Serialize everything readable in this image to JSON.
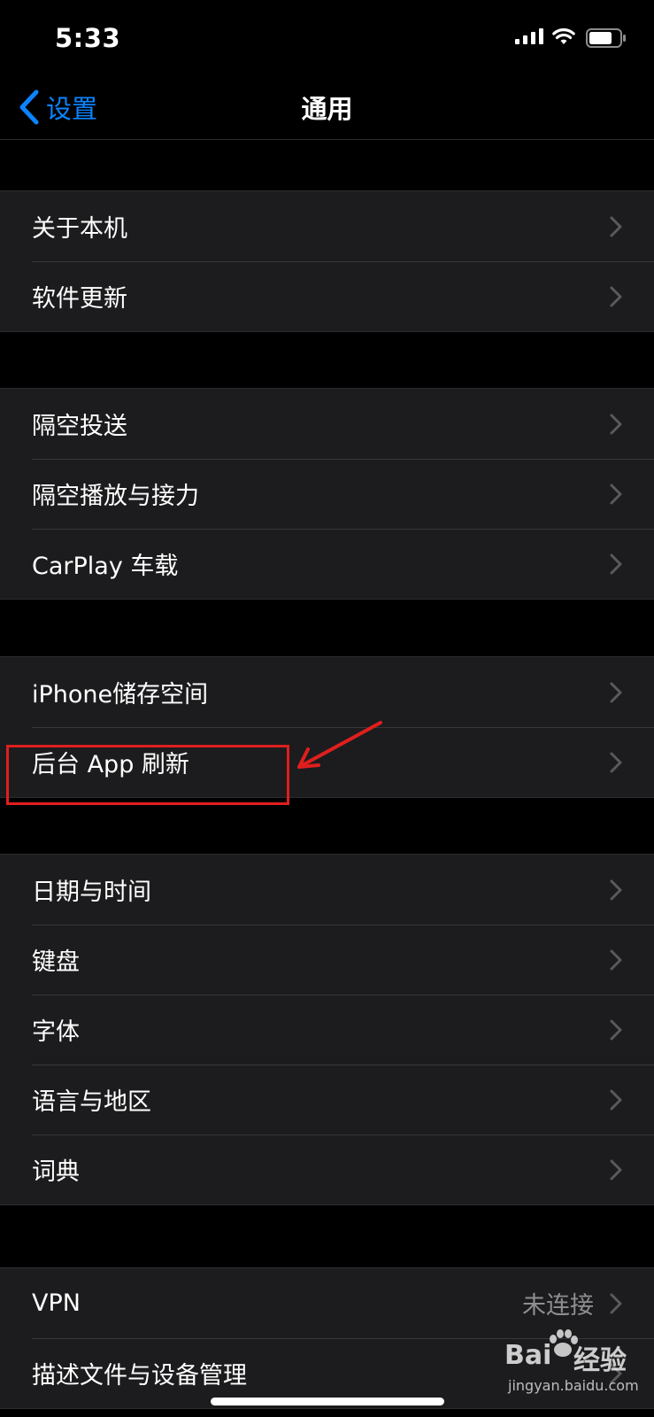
{
  "status": {
    "time": "5:33"
  },
  "nav": {
    "back_label": "设置",
    "title": "通用"
  },
  "groups": [
    {
      "items": [
        {
          "label": "关于本机"
        },
        {
          "label": "软件更新"
        }
      ]
    },
    {
      "items": [
        {
          "label": "隔空投送"
        },
        {
          "label": "隔空播放与接力"
        },
        {
          "label": "CarPlay 车载"
        }
      ]
    },
    {
      "items": [
        {
          "label": "iPhone储存空间"
        },
        {
          "label": "后台 App 刷新"
        }
      ]
    },
    {
      "items": [
        {
          "label": "日期与时间"
        },
        {
          "label": "键盘"
        },
        {
          "label": "字体"
        },
        {
          "label": "语言与地区"
        },
        {
          "label": "词典"
        }
      ]
    },
    {
      "items": [
        {
          "label": "VPN",
          "value": "未连接"
        },
        {
          "label": "描述文件与设备管理"
        }
      ]
    }
  ],
  "watermark": {
    "brand": "Bai",
    "brand2": "经验",
    "url": "jingyan.baidu.com"
  },
  "colors": {
    "accent": "#0a84ff",
    "annotation": "#e01e1e"
  }
}
